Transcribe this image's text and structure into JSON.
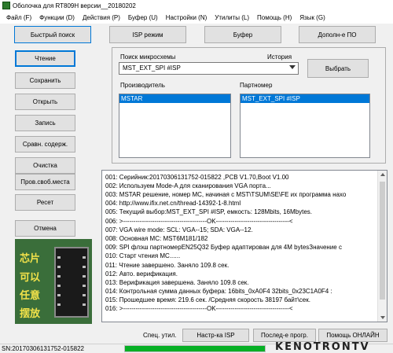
{
  "window": {
    "title": "Оболочка для RT809H версии__20180202"
  },
  "menu": [
    "Файл (F)",
    "Функции (D)",
    "Действия (P)",
    "Буфер (U)",
    "Настройки (N)",
    "Утилиты (L)",
    "Помощь (H)",
    "Язык (G)"
  ],
  "top_buttons": {
    "quick_search": "Быстрый поиск",
    "isp_mode": "ISP режим",
    "buffer": "Буфер",
    "extra_software": "Дополн-е ПО"
  },
  "left_buttons": {
    "read": "Чтение",
    "save": "Сохранить",
    "open": "Открыть",
    "write": "Запись",
    "compare": "Сравн. содерж.",
    "erase": "Очистка",
    "blank_check": "Пров.своб.места",
    "reset": "Ресет",
    "cancel": "Отмена"
  },
  "chip_search": {
    "label": "Поиск микросхемы",
    "history_label": "История",
    "value": "MST_EXT_SPI #ISP",
    "select_button": "Выбрать",
    "manufacturer_label": "Производитель",
    "manufacturer_selected": "MSTAR",
    "partnumber_label": "Партномер",
    "partnumber_selected": "MST_EXT_SPI #ISP"
  },
  "log": [
    "001:  Серийник:20170306131752-015822  ,PCB V1.70,Boot V1.00",
    "002:  Используем Mode-A для сканирования VGA порта...",
    "003:  MSTAR решение, номер MC, начиная с MST\\TSUM\\SE\\FE их программа нахо",
    "004:  http://www.ifix.net.cn/thread-14392-1-8.html",
    "005:  Текущий выбор:MST_EXT_SPI #ISP, емкость: 128Mbits, 16Mbytes.",
    "006:  >----------------------------------------OK-----------------------------------<",
    "007:  VGA wire mode: SCL: VGA--15; SDA: VGA--12.",
    "008:  Основная MC: MST6M181/182",
    "009:  SPI флэш партномерEN25Q32 Буфер адаптирован для 4M bytesЗначение с",
    "010:  Старт чтения MC......",
    "011:  Чтение завершено. Заняло 109.8 сек.",
    "012:  Авто. верификация.",
    "013:  Верификация завершена. Заняло 109.8 сек.",
    "014:  Контрольная сумма данных буфера: 16bits_0xA0F4  32bits_0x23C1A0F4 :",
    "015:  Прошедшее время: 219.6 сек.  /Средняя скорость 38197 байт\\сек.",
    "016:  >----------------------------------------OK-----------------------------------<"
  ],
  "chip_image_text": [
    "芯片",
    "可以",
    "任意",
    "摆放"
  ],
  "bottom": {
    "spec_label": "Спец. утил.",
    "isp_settings": "Настр-ка ISP",
    "last_prog": "Послед-е прогр.",
    "help_online": "Помощь ОНЛАЙН"
  },
  "status": {
    "serial": "SN:20170306131752-015822",
    "progress_fraction": 1.0
  },
  "watermark": "KENOTRONTV",
  "colors": {
    "accent": "#0078d7",
    "progress": "#06b025",
    "chip_bg": "#3a6e3a",
    "chip_text": "#f2e24a"
  }
}
